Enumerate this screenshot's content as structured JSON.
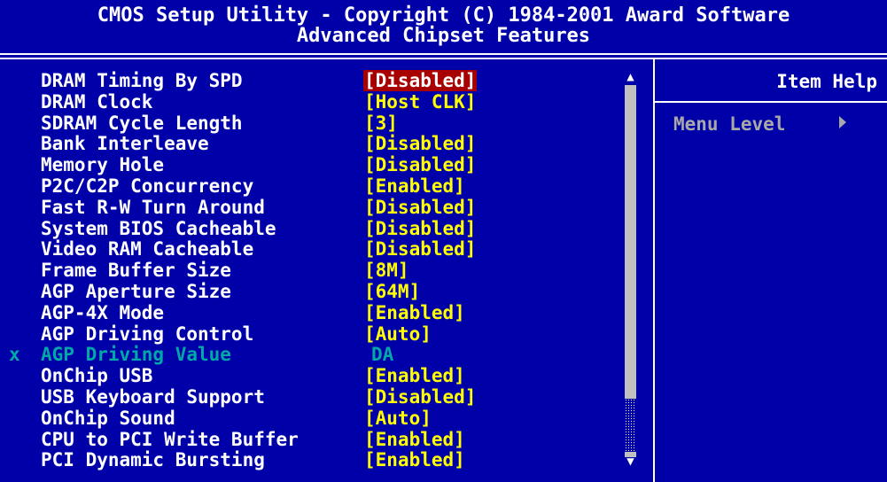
{
  "header": {
    "title_line1": "CMOS Setup Utility - Copyright (C) 1984-2001 Award Software",
    "title_line2": "Advanced Chipset Features"
  },
  "settings": [
    {
      "prefix": "",
      "label": "DRAM Timing By SPD",
      "value": "[Disabled]",
      "selected": true,
      "disabled": false
    },
    {
      "prefix": "",
      "label": "DRAM Clock",
      "value": "[Host CLK]",
      "selected": false,
      "disabled": false
    },
    {
      "prefix": "",
      "label": "SDRAM Cycle Length",
      "value": "[3]",
      "selected": false,
      "disabled": false
    },
    {
      "prefix": "",
      "label": "Bank Interleave",
      "value": "[Disabled]",
      "selected": false,
      "disabled": false
    },
    {
      "prefix": "",
      "label": "Memory Hole",
      "value": "[Disabled]",
      "selected": false,
      "disabled": false
    },
    {
      "prefix": "",
      "label": "P2C/C2P Concurrency",
      "value": "[Enabled]",
      "selected": false,
      "disabled": false
    },
    {
      "prefix": "",
      "label": "Fast R-W Turn Around",
      "value": "[Disabled]",
      "selected": false,
      "disabled": false
    },
    {
      "prefix": "",
      "label": "System BIOS Cacheable",
      "value": "[Disabled]",
      "selected": false,
      "disabled": false
    },
    {
      "prefix": "",
      "label": "Video RAM Cacheable",
      "value": "[Disabled]",
      "selected": false,
      "disabled": false
    },
    {
      "prefix": "",
      "label": "Frame Buffer Size",
      "value": "[8M]",
      "selected": false,
      "disabled": false
    },
    {
      "prefix": "",
      "label": "AGP Aperture Size",
      "value": "[64M]",
      "selected": false,
      "disabled": false
    },
    {
      "prefix": "",
      "label": "AGP-4X Mode",
      "value": "[Enabled]",
      "selected": false,
      "disabled": false
    },
    {
      "prefix": "",
      "label": "AGP Driving Control",
      "value": "[Auto]",
      "selected": false,
      "disabled": false
    },
    {
      "prefix": "x",
      "label": "AGP Driving Value",
      "value": "DA",
      "selected": false,
      "disabled": true
    },
    {
      "prefix": "",
      "label": "OnChip USB",
      "value": "[Enabled]",
      "selected": false,
      "disabled": false
    },
    {
      "prefix": "",
      "label": "USB Keyboard Support",
      "value": "[Disabled]",
      "selected": false,
      "disabled": false
    },
    {
      "prefix": "",
      "label": "OnChip Sound",
      "value": "[Auto]",
      "selected": false,
      "disabled": false
    },
    {
      "prefix": "",
      "label": "CPU to PCI Write Buffer",
      "value": "[Enabled]",
      "selected": false,
      "disabled": false
    },
    {
      "prefix": "",
      "label": "PCI Dynamic Bursting",
      "value": "[Enabled]",
      "selected": false,
      "disabled": false
    }
  ],
  "help": {
    "title": "Item Help",
    "menu_level_label": "Menu Level"
  },
  "colors": {
    "background": "#0000a8",
    "label": "#ffffff",
    "value": "#ffff00",
    "selected_bg": "#a80000",
    "disabled": "#00a8a8",
    "muted": "#a8a8a8"
  },
  "icons": {
    "scroll_up": "up-triangle-icon",
    "scroll_down": "down-triangle-icon",
    "menu_level_arrow": "right-triangle-icon"
  }
}
